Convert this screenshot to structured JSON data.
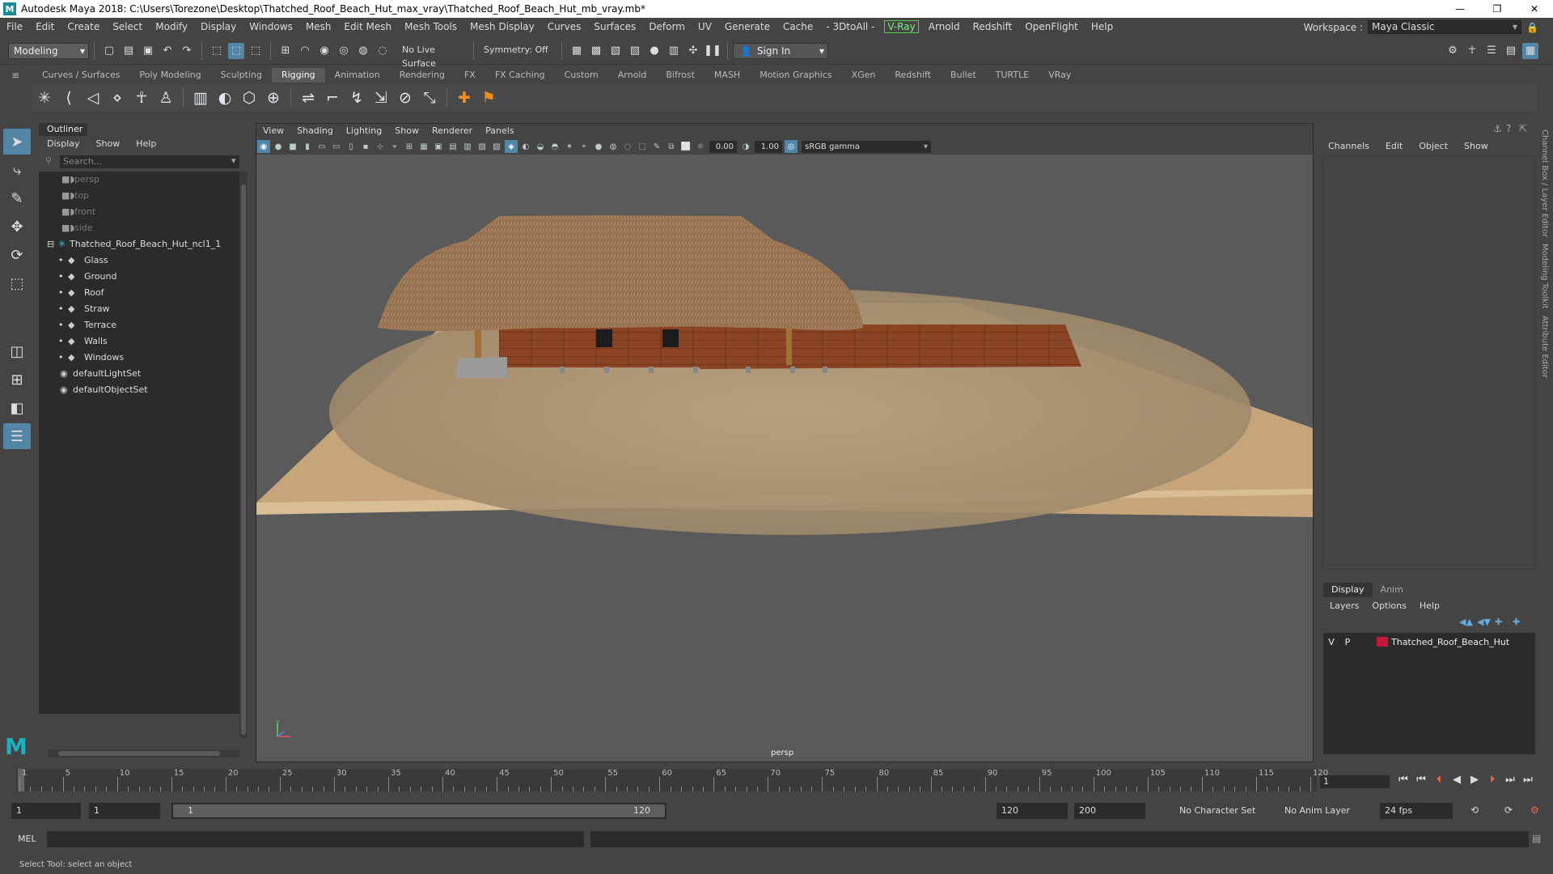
{
  "window": {
    "title": "Autodesk Maya 2018: C:\\Users\\Torezone\\Desktop\\Thatched_Roof_Beach_Hut_max_vray\\Thatched_Roof_Beach_Hut_mb_vray.mb*",
    "logo": "M",
    "minimize": "—",
    "maximize": "❐",
    "close": "✕"
  },
  "menu": [
    "File",
    "Edit",
    "Create",
    "Select",
    "Modify",
    "Display",
    "Windows",
    "Mesh",
    "Edit Mesh",
    "Mesh Tools",
    "Mesh Display",
    "Curves",
    "Surfaces",
    "Deform",
    "UV",
    "Generate",
    "Cache",
    "- 3DtoAll -",
    "V-Ray",
    "Arnold",
    "Redshift",
    "OpenFlight",
    "Help"
  ],
  "workspace": {
    "label": "Workspace :",
    "value": "Maya Classic"
  },
  "statusline": {
    "mode": "Modeling",
    "live_surface": "No Live Surface",
    "symmetry": "Symmetry: Off",
    "sign_in": "Sign In"
  },
  "shelf": {
    "tabs": [
      "Curves / Surfaces",
      "Poly Modeling",
      "Sculpting",
      "Rigging",
      "Animation",
      "Rendering",
      "FX",
      "FX Caching",
      "Custom",
      "Arnold",
      "Bifrost",
      "MASH",
      "Motion Graphics",
      "XGen",
      "Redshift",
      "Bullet",
      "TURTLE",
      "VRay"
    ],
    "active_tab": "Rigging"
  },
  "outliner": {
    "tab": "Outliner",
    "menu": [
      "Display",
      "Show",
      "Help"
    ],
    "search_placeholder": "Search...",
    "items": [
      {
        "label": "persp",
        "type": "camera"
      },
      {
        "label": "top",
        "type": "camera"
      },
      {
        "label": "front",
        "type": "camera"
      },
      {
        "label": "side",
        "type": "camera"
      },
      {
        "label": "Thatched_Roof_Beach_Hut_ncl1_1",
        "type": "group"
      },
      {
        "label": "Glass",
        "type": "mesh"
      },
      {
        "label": "Ground",
        "type": "mesh"
      },
      {
        "label": "Roof",
        "type": "mesh"
      },
      {
        "label": "Straw",
        "type": "mesh"
      },
      {
        "label": "Terrace",
        "type": "mesh"
      },
      {
        "label": "Walls",
        "type": "mesh"
      },
      {
        "label": "Windows",
        "type": "mesh"
      },
      {
        "label": "defaultLightSet",
        "type": "set"
      },
      {
        "label": "defaultObjectSet",
        "type": "set"
      }
    ]
  },
  "viewport": {
    "menu": [
      "View",
      "Shading",
      "Lighting",
      "Show",
      "Renderer",
      "Panels"
    ],
    "exposure": "0.00",
    "gamma": "1.00",
    "color_space": "sRGB gamma",
    "camera": "persp"
  },
  "channelbox": {
    "menu": [
      "Channels",
      "Edit",
      "Object",
      "Show"
    ],
    "layer_tabs": [
      "Display",
      "Anim"
    ],
    "layer_menu": [
      "Layers",
      "Options",
      "Help"
    ],
    "layer": {
      "v": "V",
      "p": "P",
      "name": "Thatched_Roof_Beach_Hut",
      "color": "#c41a3a"
    }
  },
  "side_tabs": [
    "Channel Box / Layer Editor",
    "Modeling Toolkit",
    "Attribute Editor"
  ],
  "timeline": {
    "ticks": [
      1,
      5,
      10,
      15,
      20,
      25,
      30,
      35,
      40,
      45,
      50,
      55,
      60,
      65,
      70,
      75,
      80,
      85,
      90,
      95,
      100,
      105,
      110,
      115,
      120
    ],
    "current_frame": "1",
    "range_start": "1",
    "playback_start": "1",
    "range_slider_start": "1",
    "range_slider_end": "120",
    "playback_end": "120",
    "range_end": "200",
    "character_set": "No Character Set",
    "anim_layer": "No Anim Layer",
    "fps": "24 fps"
  },
  "command": {
    "label": "MEL",
    "help": "Select Tool: select an object"
  }
}
